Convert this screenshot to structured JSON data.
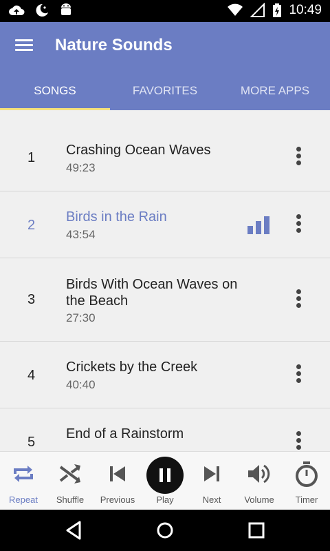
{
  "status_bar": {
    "time": "10:49",
    "icons": [
      "cloud-upload-icon",
      "notification-moon-icon",
      "android-icon",
      "wifi-icon",
      "no-signal-icon",
      "battery-charging-icon"
    ]
  },
  "app": {
    "title": "Nature Sounds",
    "menu_icon": "hamburger-menu-icon"
  },
  "tabs": [
    {
      "label": "SONGS",
      "active": true
    },
    {
      "label": "FAVORITES",
      "active": false
    },
    {
      "label": "MORE APPS",
      "active": false
    }
  ],
  "songs": [
    {
      "number": "1",
      "title": "Crashing Ocean Waves",
      "duration": "49:23",
      "playing": false
    },
    {
      "number": "2",
      "title": "Birds in the Rain",
      "duration": "43:54",
      "playing": true
    },
    {
      "number": "3",
      "title": "Birds With Ocean Waves on the Beach",
      "duration": "27:30",
      "playing": false
    },
    {
      "number": "4",
      "title": "Crickets by the Creek",
      "duration": "40:40",
      "playing": false
    },
    {
      "number": "5",
      "title": "End of a Rainstorm",
      "duration": "",
      "playing": false
    }
  ],
  "player": {
    "controls": [
      {
        "label": "Repeat",
        "icon": "repeat-icon",
        "active": true
      },
      {
        "label": "Shuffle",
        "icon": "shuffle-icon",
        "active": false
      },
      {
        "label": "Previous",
        "icon": "skip-previous-icon",
        "active": false
      },
      {
        "label": "Play",
        "icon": "pause-icon",
        "active": false
      },
      {
        "label": "Next",
        "icon": "skip-next-icon",
        "active": false
      },
      {
        "label": "Volume",
        "icon": "volume-icon",
        "active": false
      },
      {
        "label": "Timer",
        "icon": "timer-icon",
        "active": false
      }
    ]
  },
  "colors": {
    "primary": "#6b7dc3",
    "tab_indicator": "#f6e27b",
    "list_background": "#f0f0f0",
    "status_bar": "#000000"
  },
  "nav_bar": {
    "buttons": [
      "back-icon",
      "home-icon",
      "recents-icon"
    ]
  }
}
